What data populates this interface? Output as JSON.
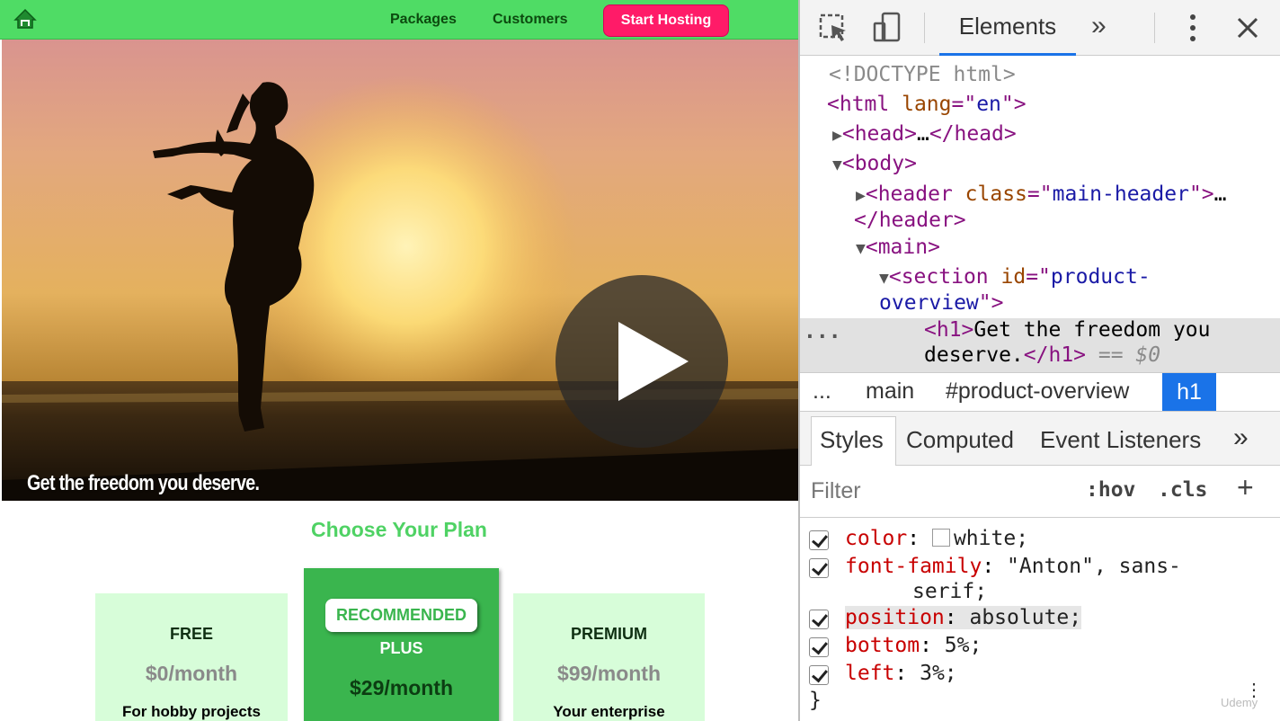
{
  "site": {
    "nav": {
      "packages": "Packages",
      "customers": "Customers",
      "cta": "Start Hosting"
    },
    "hero_title": "Get the freedom you deserve.",
    "plans_title": "Choose Your Plan",
    "plans": [
      {
        "name": "FREE",
        "price": "$0/month",
        "desc": "For hobby projects"
      },
      {
        "badge": "RECOMMENDED",
        "name": "PLUS",
        "price": "$29/month"
      },
      {
        "name": "PREMIUM",
        "price": "$99/month",
        "desc": "Your enterprise"
      }
    ],
    "colors": {
      "header_green": "#4fdc65",
      "cta_pink": "#ff1b68",
      "plan_bg": "#d7fdd9",
      "plus_bg": "#3ab54e"
    }
  },
  "devtools": {
    "tabs": {
      "elements": "Elements",
      "more": "»"
    },
    "dom": {
      "doctype": "<!DOCTYPE html>",
      "html_tag": "html",
      "lang_attr": "lang",
      "lang_val": "en",
      "head": "head",
      "body": "body",
      "header_tag": "header",
      "class_attr": "class",
      "class_val": "main-header",
      "main": "main",
      "section": "section",
      "id_attr": "id",
      "id_val_1": "product-",
      "id_val_2": "overview",
      "h1_text_1": "Get the freedom you",
      "h1_text_2": "deserve.",
      "eq": "== $0",
      "ellipsis": "…",
      "row_dots": "..."
    },
    "breadcrumbs": {
      "dots": "...",
      "main": "main",
      "section": "#product-overview",
      "h1": "h1"
    },
    "style_tabs": {
      "styles": "Styles",
      "computed": "Computed",
      "listeners": "Event Listeners",
      "more": "»"
    },
    "filter": {
      "placeholder": "Filter",
      "hov": ":hov",
      "cls": ".cls",
      "add": "+"
    },
    "rules": [
      {
        "prop": "color",
        "value": "white;"
      },
      {
        "prop": "font-family",
        "value": "\"Anton\", sans-",
        "value_cont": "serif;"
      },
      {
        "prop": "position",
        "value": "absolute;"
      },
      {
        "prop": "bottom",
        "value": "5%;"
      },
      {
        "prop": "left",
        "value": "3%;"
      }
    ],
    "close_brace": "}",
    "watermark": "Udemy"
  }
}
